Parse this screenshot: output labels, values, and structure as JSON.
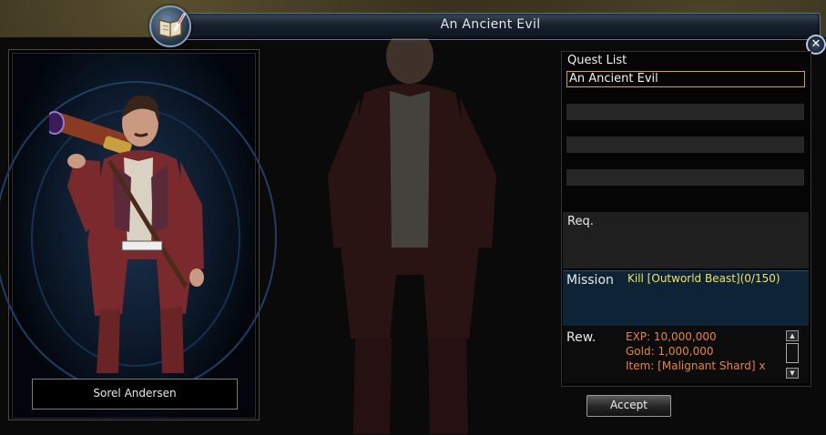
{
  "window": {
    "title": "An Ancient Evil"
  },
  "npc": {
    "name": "Sorel Andersen"
  },
  "quest_list": {
    "title": "Quest List",
    "items": [
      "An Ancient Evil"
    ]
  },
  "requirements": {
    "label": "Req."
  },
  "mission": {
    "label": "Mission",
    "text": "Kill [Outworld Beast](0/150)"
  },
  "reward": {
    "label": "Rew.",
    "exp": "EXP: 10,000,000",
    "gold": "Gold: 1,000,000",
    "item": "Item: [Malignant Shard] x"
  },
  "buttons": {
    "accept": "Accept"
  },
  "icons": {
    "title": "book-quill-icon",
    "close": "close-icon",
    "scroll_up": "arrow-up-icon",
    "scroll_down": "arrow-down-icon"
  },
  "colors": {
    "highlight_border": "#d8a818",
    "mission_text": "#f3e35a",
    "reward_text": "#e8862e",
    "mission_bg": "#0e2436"
  }
}
